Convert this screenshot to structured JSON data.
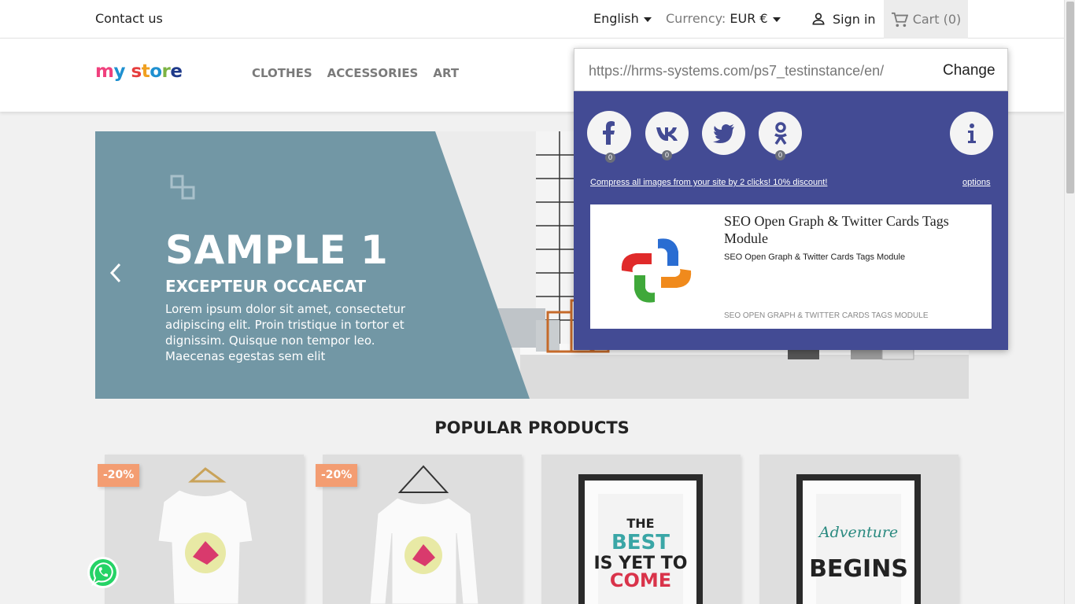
{
  "topbar": {
    "contact": "Contact us",
    "language": "English",
    "currency_label": "Currency:",
    "currency_value": "EUR €",
    "signin": "Sign in",
    "cart": "Cart (0)"
  },
  "header": {
    "logo_text": "my store",
    "nav": [
      "CLOTHES",
      "ACCESSORIES",
      "ART"
    ]
  },
  "slider": {
    "title": "SAMPLE 1",
    "subtitle": "EXCEPTEUR OCCAECAT",
    "text": "Lorem ipsum dolor sit amet, consectetur adipiscing elit. Proin tristique in tortor et dignissim. Quisque non tempor leo. Maecenas egestas sem elit"
  },
  "popular": {
    "heading": "POPULAR PRODUCTS",
    "badges": [
      "-20%",
      "-20%"
    ]
  },
  "share_popup": {
    "url": "https://hrms-systems.com/ps7_testinstance/en/",
    "change_button": "Change",
    "social": [
      {
        "name": "facebook",
        "count": "0"
      },
      {
        "name": "vk",
        "count": "0"
      },
      {
        "name": "twitter",
        "count": ""
      },
      {
        "name": "odnoklassniki",
        "count": "0"
      }
    ],
    "compress_link": "Compress all images from your site by 2 clicks! 10% discount!",
    "options_link": "options",
    "card": {
      "title": "SEO Open Graph & Twitter Cards Tags Module",
      "subtitle": "SEO Open Graph & Twitter Cards Tags Module",
      "footer": "SEO OPEN GRAPH & TWITTER CARDS TAGS MODULE"
    }
  },
  "colors": {
    "popup_bg": "#434b94",
    "slide_panel": "#7297a5",
    "badge": "#f39d72",
    "whatsapp": "#25d366"
  }
}
